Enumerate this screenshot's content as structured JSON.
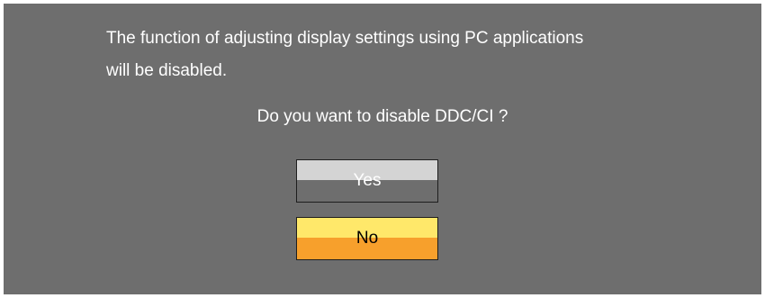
{
  "dialog": {
    "message_line1": "The function of adjusting display settings using PC applications",
    "message_line2": "will be disabled.",
    "question": "Do you want to disable DDC/CI ?",
    "buttons": {
      "yes_label": "Yes",
      "no_label": "No"
    },
    "colors": {
      "background": "#6e6e6e",
      "yes_top": "#d4d4d4",
      "no_top": "#ffe86a",
      "no_bottom": "#f7a02c"
    }
  }
}
